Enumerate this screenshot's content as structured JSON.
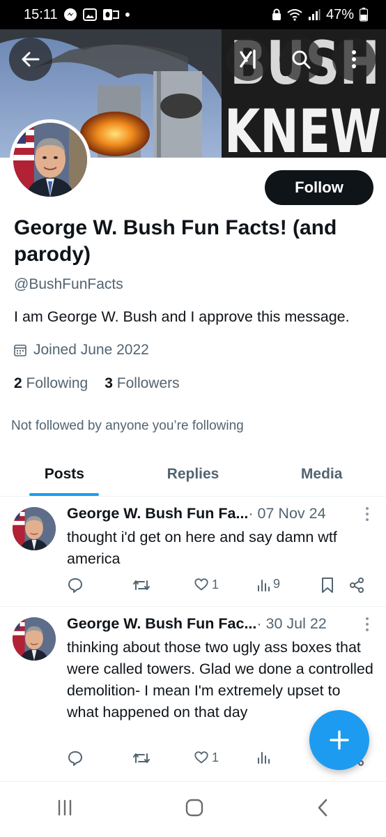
{
  "status_bar": {
    "time": "15:11",
    "battery": "47%",
    "icons": [
      "messenger-icon",
      "gallery-icon",
      "outlook-icon",
      "dot-icon",
      "lock-icon",
      "wifi-icon",
      "signal-icon",
      "battery-icon"
    ]
  },
  "banner": {
    "text_line1": "BUSH",
    "text_line2": "KNEW",
    "buttons": [
      "back-arrow-icon",
      "grok-icon",
      "search-icon",
      "more-vertical-icon"
    ]
  },
  "profile": {
    "follow_label": "Follow",
    "display_name": "George W. Bush Fun Facts! (and parody)",
    "handle": "@BushFunFacts",
    "bio": "I am George W. Bush and I approve this message.",
    "joined": "Joined June 2022",
    "following_count": "2",
    "following_label": "Following",
    "followers_count": "3",
    "followers_label": "Followers",
    "not_followed": "Not followed by anyone you’re following"
  },
  "tabs": [
    {
      "label": "Posts",
      "active": true
    },
    {
      "label": "Replies",
      "active": false
    },
    {
      "label": "Media",
      "active": false
    }
  ],
  "posts": [
    {
      "name": "George W. Bush Fun Fa...",
      "date": " · 07 Nov 24",
      "text": "thought i'd get on here and say damn wtf america",
      "likes": "1",
      "views": "9"
    },
    {
      "name": "George W. Bush Fun Fac...",
      "date": " · 30 Jul 22",
      "text": "thinking about those two ugly ass boxes that were called towers. Glad we done a controlled demolition- I mean I'm extremely upset to what happened on that day",
      "likes": "1",
      "views": ""
    }
  ],
  "colors": {
    "accent": "#1d9bf0",
    "text": "#0f1419",
    "muted": "#536471",
    "follow_bg": "#0f1419"
  }
}
